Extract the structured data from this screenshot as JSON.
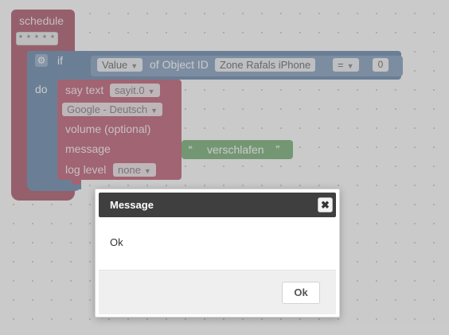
{
  "workspace": {
    "schedule_label": "schedule",
    "schedule_field": "* * * * *",
    "if_label": "if",
    "do_label": "do",
    "value_dropdown": "Value",
    "of_object_label": "of Object ID",
    "object_dropdown": "Zone Rafals iPhone",
    "operator_dropdown": "=",
    "compare_value": "0",
    "say_text_label": "say text",
    "say_target_dropdown": "sayit.0",
    "language_dropdown": "Google - Deutsch",
    "volume_label": "volume (optional)",
    "message_label": "message",
    "log_level_label": "log level",
    "log_level_dropdown": "none",
    "message_text": "verschlafen"
  },
  "dialog": {
    "title": "Message",
    "close_symbol": "✖",
    "message": "Ok",
    "ok_label": "Ok"
  },
  "colors": {
    "schedule_block": "#a5475e",
    "if_block": "#5b7fa6",
    "say_block": "#b8506a",
    "text_block": "#6aa86a",
    "dialog_titlebar": "#3f3f3f"
  }
}
